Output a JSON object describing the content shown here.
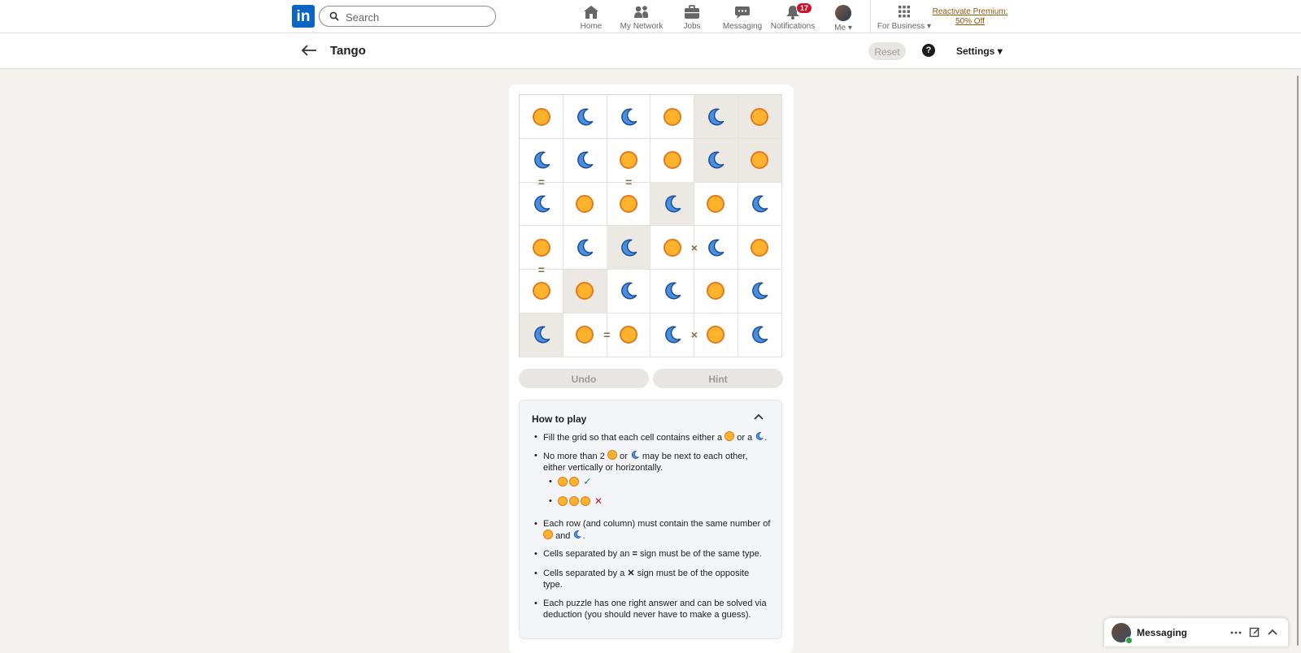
{
  "nav": {
    "search_placeholder": "Search",
    "items": [
      {
        "label": "Home",
        "icon": "home-icon"
      },
      {
        "label": "My Network",
        "icon": "network-icon"
      },
      {
        "label": "Jobs",
        "icon": "briefcase-icon"
      },
      {
        "label": "Messaging",
        "icon": "chat-icon"
      },
      {
        "label": "Notifications",
        "icon": "bell-icon",
        "badge": "17"
      },
      {
        "label": "Me",
        "icon": "avatar"
      },
      {
        "label": "For Business",
        "icon": "grid-icon"
      }
    ],
    "premium_line1": "Reactivate Premium:",
    "premium_line2": "50% Off"
  },
  "header": {
    "title": "Tango",
    "reset_label": "Reset",
    "help_label": "?",
    "settings_label": "Settings"
  },
  "board": {
    "rows": [
      [
        "sun",
        "moon",
        "moon",
        "sun",
        "moon",
        "sun"
      ],
      [
        "moon",
        "moon",
        "sun",
        "sun",
        "moon",
        "sun"
      ],
      [
        "moon",
        "sun",
        "sun",
        "moon",
        "sun",
        "moon"
      ],
      [
        "sun",
        "moon",
        "moon",
        "sun",
        "moon",
        "sun"
      ],
      [
        "sun",
        "sun",
        "moon",
        "moon",
        "sun",
        "moon"
      ],
      [
        "moon",
        "sun",
        "sun",
        "moon",
        "sun",
        "moon"
      ]
    ],
    "locked": [
      [
        0,
        4
      ],
      [
        0,
        5
      ],
      [
        1,
        4
      ],
      [
        1,
        5
      ],
      [
        2,
        3
      ],
      [
        3,
        2
      ],
      [
        4,
        1
      ],
      [
        5,
        0
      ]
    ],
    "constraints": [
      {
        "type": "=",
        "between": [
          [
            1,
            0
          ],
          [
            2,
            0
          ]
        ]
      },
      {
        "type": "=",
        "between": [
          [
            1,
            2
          ],
          [
            2,
            2
          ]
        ]
      },
      {
        "type": "×",
        "between": [
          [
            3,
            3
          ],
          [
            3,
            4
          ]
        ]
      },
      {
        "type": "=",
        "between": [
          [
            3,
            0
          ],
          [
            4,
            0
          ]
        ]
      },
      {
        "type": "=",
        "between": [
          [
            5,
            1
          ],
          [
            5,
            2
          ]
        ]
      },
      {
        "type": "×",
        "between": [
          [
            5,
            3
          ],
          [
            5,
            4
          ]
        ]
      }
    ]
  },
  "controls": {
    "undo_label": "Undo",
    "hint_label": "Hint"
  },
  "howto": {
    "title": "How to play",
    "rule1_a": "Fill the grid so that each cell contains either a",
    "rule1_b": "or a",
    "rule1_c": ".",
    "rule2_a": "No more than 2",
    "rule2_b": "or",
    "rule2_c": "may be next to each other,",
    "rule2_d": "either vertically or horizontally.",
    "check_mark": "✓",
    "cross_mark": "✕",
    "rule3_a": "Each row (and column) must contain the same number of",
    "rule3_b": "and",
    "rule3_c": ".",
    "rule4_a": "Cells separated by an",
    "rule4_sign": "=",
    "rule4_b": "sign must be of the same type.",
    "rule5_a": "Cells separated by a",
    "rule5_sign": "✕",
    "rule5_b": "sign must be of the opposite",
    "rule5_c": "type.",
    "rule6_a": "Each puzzle has one right answer and can be solved via",
    "rule6_b": "deduction (you should never have to make a guess)."
  },
  "messaging": {
    "label": "Messaging"
  },
  "colors": {
    "sun_fill": "#ffb32c",
    "sun_stroke": "#e07a1b",
    "moon_fill": "#4a8ee0",
    "moon_stroke": "#1c4f99",
    "linkedin_blue": "#0a66c2",
    "badge_red": "#cb112d"
  }
}
